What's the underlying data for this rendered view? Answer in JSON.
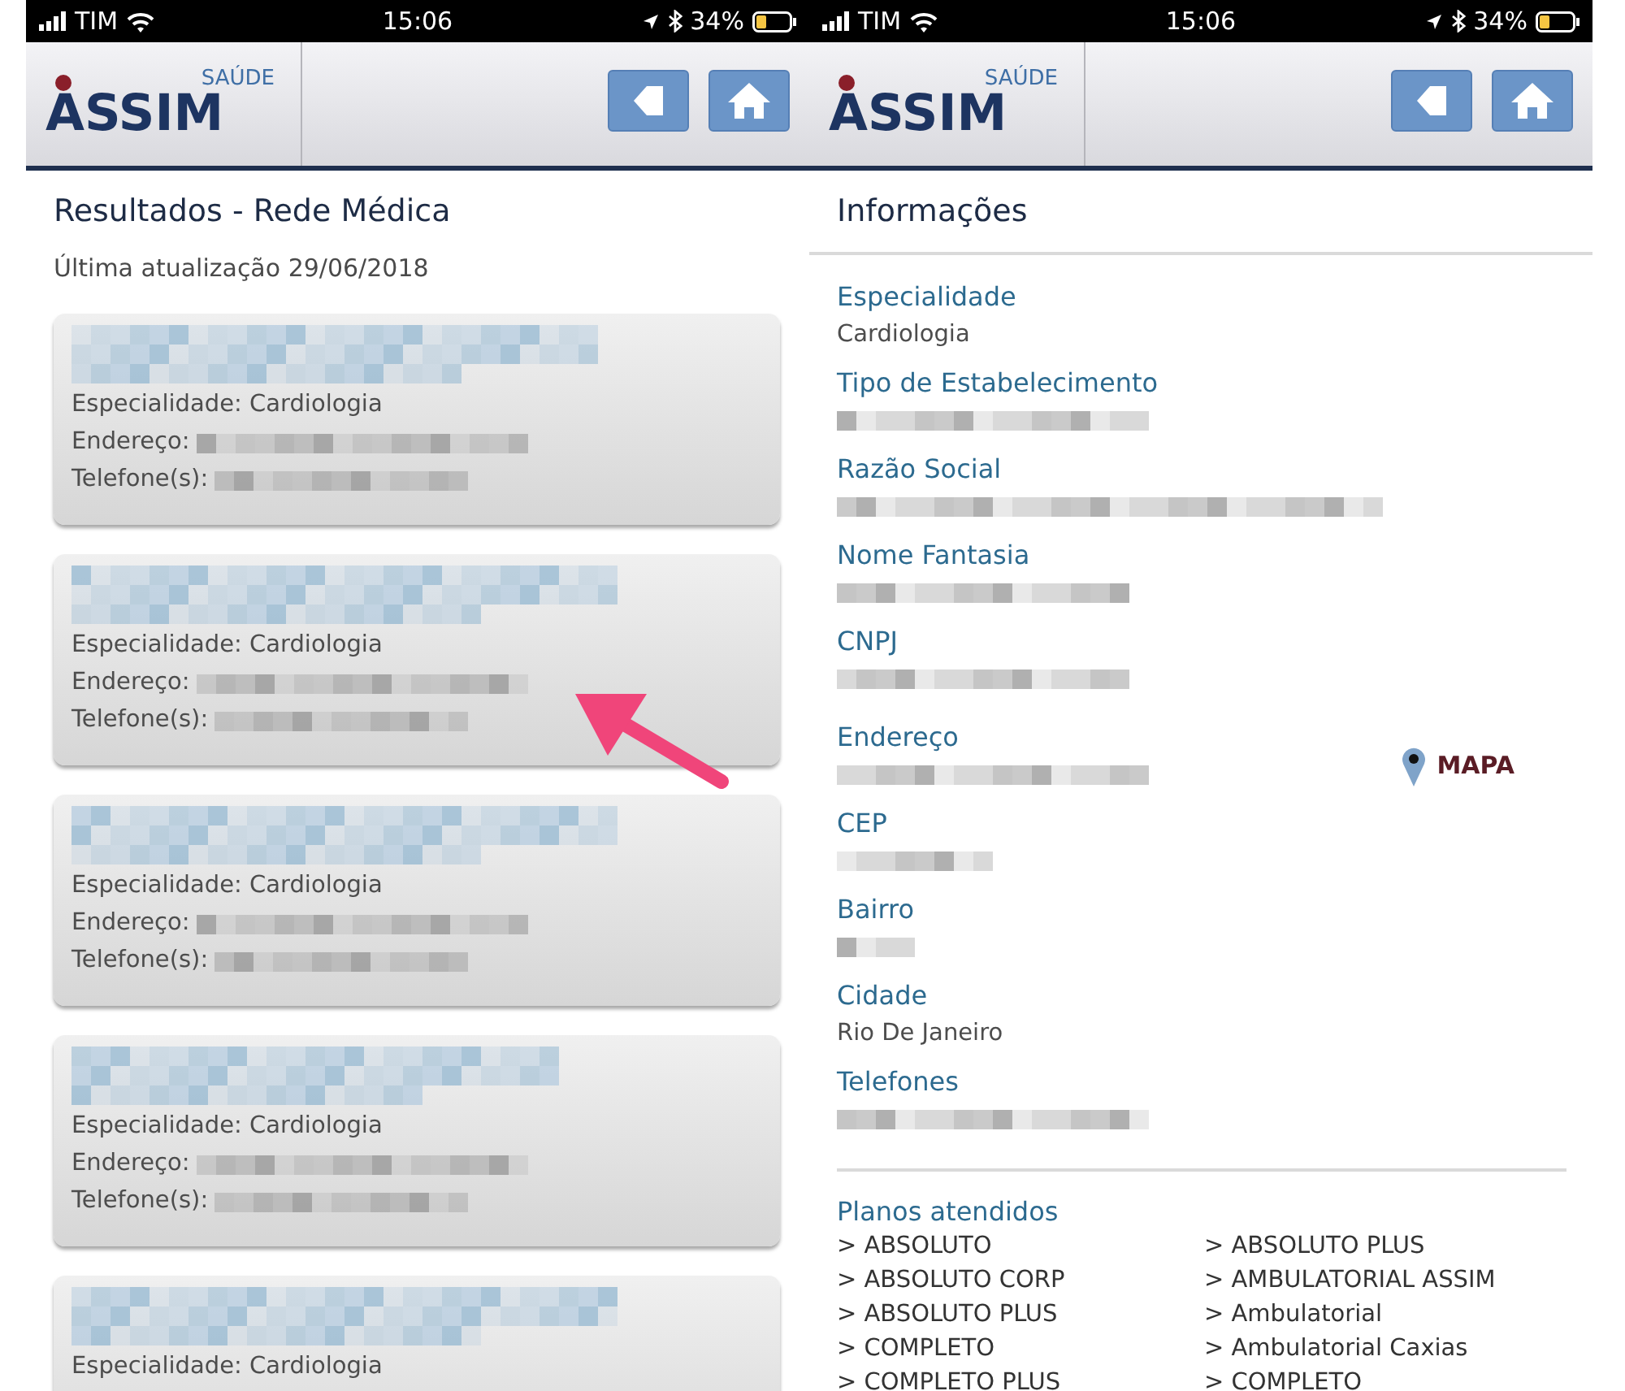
{
  "screens": [
    {
      "status_bar": {
        "carrier": "TIM",
        "time": "15:06",
        "battery": "34%"
      },
      "header": {
        "logo_top": "SAÚDE",
        "logo_main": "ASSIM"
      },
      "title": "Resultados - Rede Médica",
      "subtitle": "Última atualização 29/06/2018",
      "results": [
        {
          "lines": [
            {
              "text": "Especialidade: Cardiologia",
              "redacted": false
            },
            {
              "text": "Endereço:",
              "redacted": true
            },
            {
              "text": "Telefone(s):",
              "redacted": true
            }
          ]
        },
        {
          "lines": [
            {
              "text": "Especialidade: Cardiologia",
              "redacted": false
            },
            {
              "text": "Endereço:",
              "redacted": true
            },
            {
              "text": "Telefone(s):",
              "redacted": true
            }
          ]
        },
        {
          "lines": [
            {
              "text": "Especialidade: Cardiologia",
              "redacted": false
            },
            {
              "text": "Endereço:",
              "redacted": true
            },
            {
              "text": "Telefone(s):",
              "redacted": true
            }
          ]
        },
        {
          "lines": [
            {
              "text": "Especialidade: Cardiologia",
              "redacted": false
            },
            {
              "text": "Endereço:",
              "redacted": true
            },
            {
              "text": "Telefone(s):",
              "redacted": true
            }
          ]
        },
        {
          "lines": [
            {
              "text": "Especialidade: Cardiologia",
              "redacted": false
            }
          ]
        }
      ]
    },
    {
      "status_bar": {
        "carrier": "TIM",
        "time": "15:06",
        "battery": "34%"
      },
      "header": {
        "logo_top": "SAÚDE",
        "logo_main": "ASSIM"
      },
      "title": "Informações",
      "fields": [
        {
          "label": "Especialidade",
          "value": "Cardiologia",
          "redacted": false
        },
        {
          "label": "Tipo de Estabelecimento",
          "redacted": true
        },
        {
          "label": "Razão Social",
          "redacted": true
        },
        {
          "label": "Nome Fantasia",
          "redacted": true
        },
        {
          "label": "CNPJ",
          "redacted": true
        },
        {
          "label": "Endereço",
          "redacted": true,
          "map_link": "MAPA"
        },
        {
          "label": "CEP",
          "redacted": true
        },
        {
          "label": "Bairro",
          "redacted": true
        },
        {
          "label": "Cidade",
          "value": "Rio De Janeiro",
          "redacted": false
        },
        {
          "label": "Telefones",
          "redacted": true
        }
      ],
      "plans": {
        "title": "Planos atendidos",
        "columns": [
          [
            "> ABSOLUTO",
            "> ABSOLUTO CORP",
            "> ABSOLUTO PLUS",
            "> COMPLETO",
            "> COMPLETO PLUS"
          ],
          [
            "> ABSOLUTO PLUS",
            "> AMBULATORIAL ASSIM",
            "> Ambulatorial",
            "> Ambulatorial Caxias",
            "> COMPLETO"
          ]
        ]
      }
    }
  ]
}
